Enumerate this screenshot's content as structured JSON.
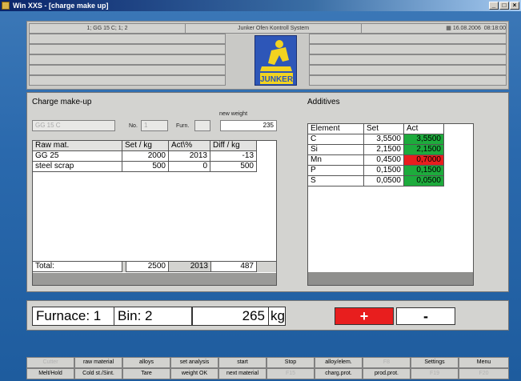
{
  "window": {
    "title": "Win XXS - [charge make up]"
  },
  "header": {
    "charge_info": "1; GG 15 C; 1; 2",
    "system_name": "Junker Ofen Kontroll System",
    "date": "16.08.2006",
    "time": "08:18:00",
    "logo_text": "JUNKER"
  },
  "charge": {
    "title": "Charge make-up",
    "grade_field": "GG 15 C",
    "no_label": "No.",
    "no_value": "1",
    "furnace_label": "Furn.",
    "furnace_value": "",
    "new_weight_label": "new weight",
    "new_weight_value": "235",
    "columns": [
      "Raw mat.",
      "Set / kg",
      "Act\\%",
      "Diff / kg"
    ],
    "rows": [
      {
        "mat": "GG 25",
        "set": "2000",
        "act": "2013",
        "diff": "-13"
      },
      {
        "mat": "steel scrap",
        "set": "500",
        "act": "0",
        "diff": "500"
      }
    ],
    "total_label": "Total:",
    "total_set": "2500",
    "total_act": "2013",
    "total_diff": "487"
  },
  "additives": {
    "title": "Additives",
    "columns": [
      "Element",
      "Set",
      "Act"
    ],
    "rows": [
      {
        "el": "C",
        "set": "3,5500",
        "act": "3,5500",
        "status": "ok"
      },
      {
        "el": "Si",
        "set": "2,1500",
        "act": "2,1500",
        "status": "ok"
      },
      {
        "el": "Mn",
        "set": "0,4500",
        "act": "0,7000",
        "status": "bad"
      },
      {
        "el": "P",
        "set": "0,1500",
        "act": "0,1500",
        "status": "ok"
      },
      {
        "el": "S",
        "set": "0,0500",
        "act": "0,0500",
        "status": "ok"
      }
    ]
  },
  "bottom": {
    "furnace": "Furnace: 1",
    "bin": "Bin: 2",
    "weight": "265",
    "unit": "kg",
    "plus": "+",
    "minus": "-"
  },
  "fkeys_row1": [
    "Cutter",
    "raw material",
    "alloys",
    "set analysis",
    "start",
    "Stop",
    "alloy/elem.",
    "F8",
    "Settings",
    "Menu"
  ],
  "fkeys_row2": [
    "Melt/Hold",
    "Cold st./Sint.",
    "Tare",
    "weight OK",
    "next material",
    "F15",
    "charg.prot.",
    "prod.prot.",
    "F19",
    "F20"
  ],
  "fkeys_dim_row1": [
    true,
    false,
    false,
    false,
    false,
    false,
    false,
    true,
    false,
    false
  ],
  "fkeys_dim_row2": [
    false,
    false,
    false,
    false,
    false,
    true,
    false,
    false,
    true,
    true
  ],
  "colors": {
    "ok": "#1dab3c",
    "bad": "#e81e1e",
    "plus_button": "#e81e1e"
  }
}
